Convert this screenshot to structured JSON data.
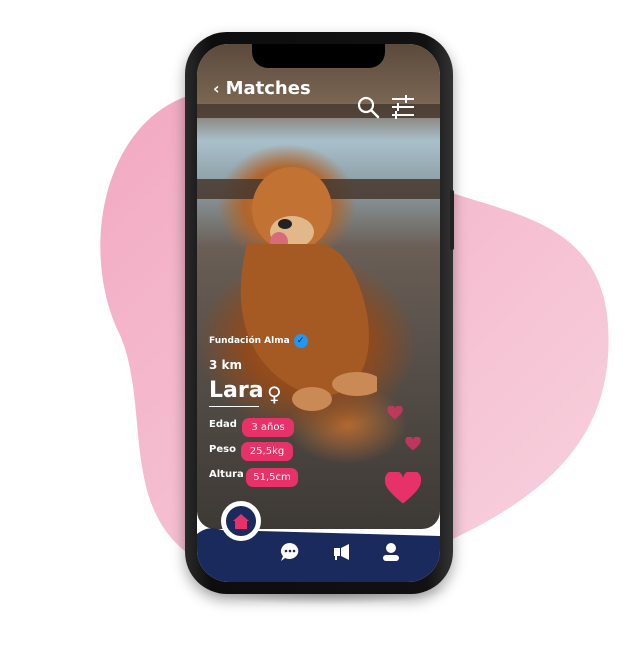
{
  "header": {
    "back_label": "Matches"
  },
  "profile": {
    "shelter": "Fundación Alma",
    "distance": "3 km",
    "name": "Lara",
    "gender_symbol": "♀",
    "attributes": [
      {
        "label": "Edad",
        "value": "3 años"
      },
      {
        "label": "Peso",
        "value": "25,5kg"
      },
      {
        "label": "Altura",
        "value": "51,5cm"
      }
    ]
  },
  "colors": {
    "accent": "#e63169",
    "nav": "#1b2a5c",
    "blob": "#f4b6cb",
    "verified": "#2196f3"
  }
}
